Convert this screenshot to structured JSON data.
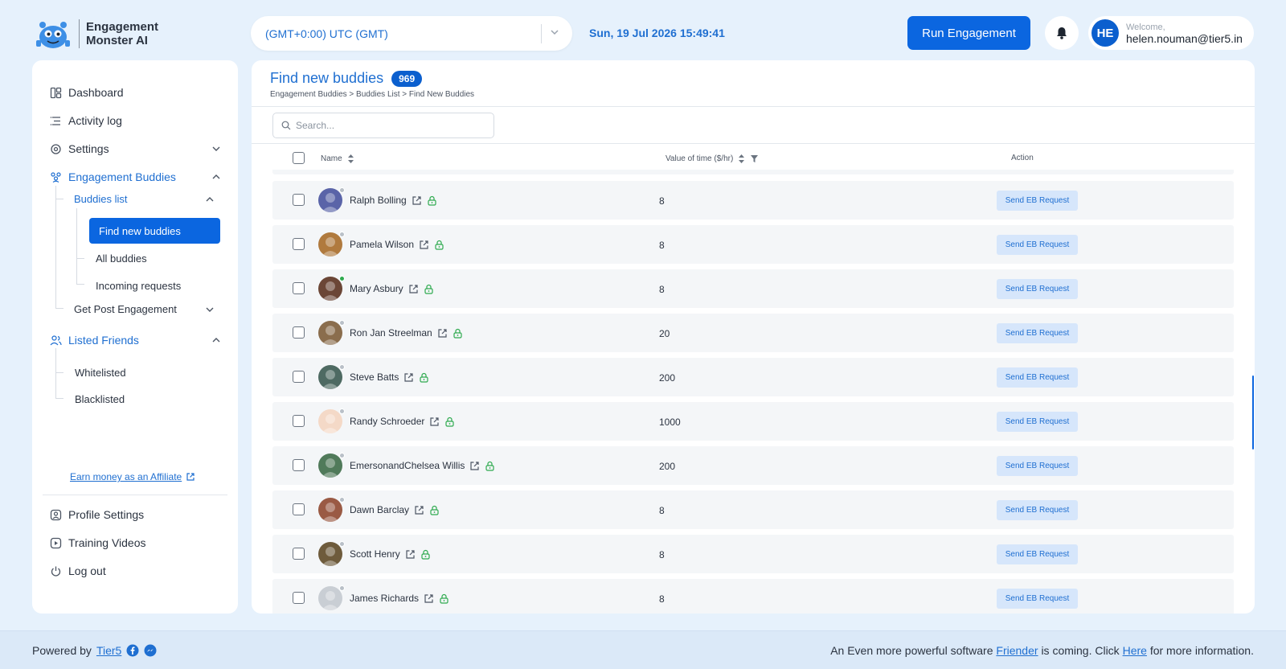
{
  "app": {
    "logo_line1": "Engagement",
    "logo_line2": "Monster AI"
  },
  "header": {
    "timezone": "(GMT+0:00) UTC (GMT)",
    "datetime": "Sun, 19 Jul 2026 15:49:41",
    "run_button": "Run Engagement",
    "welcome": "Welcome,",
    "email": "helen.nouman@tier5.in",
    "avatar_initials": "HE"
  },
  "sidebar": {
    "dashboard": "Dashboard",
    "activity_log": "Activity log",
    "settings": "Settings",
    "engagement_buddies": "Engagement Buddies",
    "buddies_list": "Buddies list",
    "find_new_buddies": "Find new buddies",
    "all_buddies": "All buddies",
    "incoming_requests": "Incoming requests",
    "get_post_engagement": "Get Post Engagement",
    "listed_friends": "Listed Friends",
    "whitelisted": "Whitelisted",
    "blacklisted": "Blacklisted",
    "affiliate": "Earn money as an Affiliate",
    "profile_settings": "Profile Settings",
    "training_videos": "Training Videos",
    "log_out": "Log out"
  },
  "main": {
    "title": "Find new buddies",
    "count": "969",
    "breadcrumb": "Engagement Buddies > Buddies List > Find New Buddies",
    "search_placeholder": "Search...",
    "columns": {
      "name": "Name",
      "value": "Value of time ($/hr)",
      "action": "Action"
    },
    "action_label": "Send EB Request",
    "rows": [
      {
        "name": "Ralph Bolling",
        "value": "8",
        "status": "#b9c0c8",
        "pic": "#5a64a8"
      },
      {
        "name": "Pamela Wilson",
        "value": "8",
        "status": "#b9c0c8",
        "pic": "#b07a3e"
      },
      {
        "name": "Mary Asbury",
        "value": "8",
        "status": "#2eaa4f",
        "pic": "#6b4636"
      },
      {
        "name": "Ron Jan Streelman",
        "value": "20",
        "status": "#b9c0c8",
        "pic": "#8a6d4d"
      },
      {
        "name": "Steve Batts",
        "value": "200",
        "status": "#b9c0c8",
        "pic": "#4e6a62"
      },
      {
        "name": "Randy Schroeder",
        "value": "1000",
        "status": "#b9c0c8",
        "pic": "#f4d9c7"
      },
      {
        "name": "EmersonandChelsea Willis",
        "value": "200",
        "status": "#b9c0c8",
        "pic": "#507a5a"
      },
      {
        "name": "Dawn Barclay",
        "value": "8",
        "status": "#b9c0c8",
        "pic": "#9a5a44"
      },
      {
        "name": "Scott Henry",
        "value": "8",
        "status": "#b9c0c8",
        "pic": "#6e5b3c"
      },
      {
        "name": "James Richards",
        "value": "8",
        "status": "#b9c0c8",
        "pic": "#c9ced4"
      }
    ]
  },
  "footer": {
    "powered_by": "Powered by",
    "tier5": "Tier5",
    "notice_pre": "An Even more powerful software",
    "friender": "Friender",
    "notice_mid": "is coming. Click",
    "here": "Here",
    "notice_post": "for more information."
  },
  "colors": {
    "primary": "#0b66e0",
    "accent_text": "#1f6fd1",
    "background": "#e6f1fc",
    "online": "#2eaa4f"
  }
}
